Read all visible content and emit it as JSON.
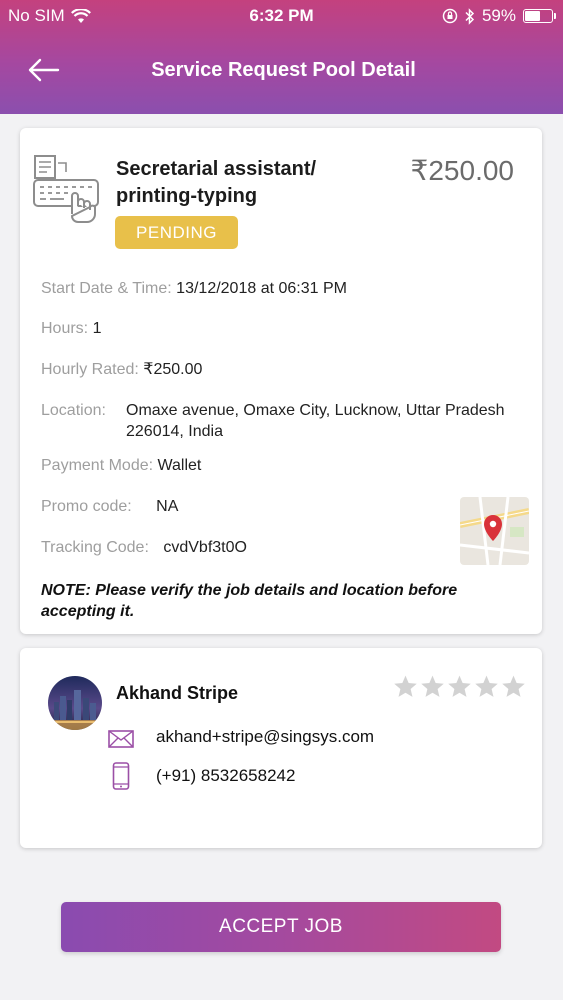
{
  "status_bar": {
    "carrier": "No SIM",
    "time": "6:32 PM",
    "battery_percent": "59%",
    "battery_level": 0.59
  },
  "header": {
    "title": "Service Request Pool Detail",
    "back_icon": "arrow-left-icon"
  },
  "job": {
    "title": "Secretarial assistant/ printing-typing",
    "price": "₹250.00",
    "status": "PENDING",
    "status_color": "#e8c04a",
    "start_label": "Start Date & Time:",
    "start_value": "13/12/2018 at 06:31 PM",
    "hours_label": "Hours:",
    "hours_value": "1",
    "rate_label": "Hourly Rated:",
    "rate_value": "₹250.00",
    "location_label": "Location:",
    "location_value": "Omaxe avenue, Omaxe City, Lucknow, Uttar Pradesh 226014, India",
    "payment_label": "Payment Mode:",
    "payment_value": "Wallet",
    "promo_label": "Promo code:",
    "promo_value": "NA",
    "tracking_label": "Tracking Code:",
    "tracking_value": "cvdVbf3t0O",
    "note": "NOTE: Please verify the job details and location before accepting it."
  },
  "customer": {
    "name": "Akhand Stripe",
    "email": "akhand+stripe@singsys.com",
    "phone": "(+91) 8532658242",
    "rating": 0,
    "rating_max": 5
  },
  "actions": {
    "accept_label": "ACCEPT JOB"
  },
  "colors": {
    "header_top": "#c4417e",
    "header_bottom": "#8b4fae",
    "accent_purple": "#9b4fa6",
    "map_pin": "#d9323a"
  }
}
